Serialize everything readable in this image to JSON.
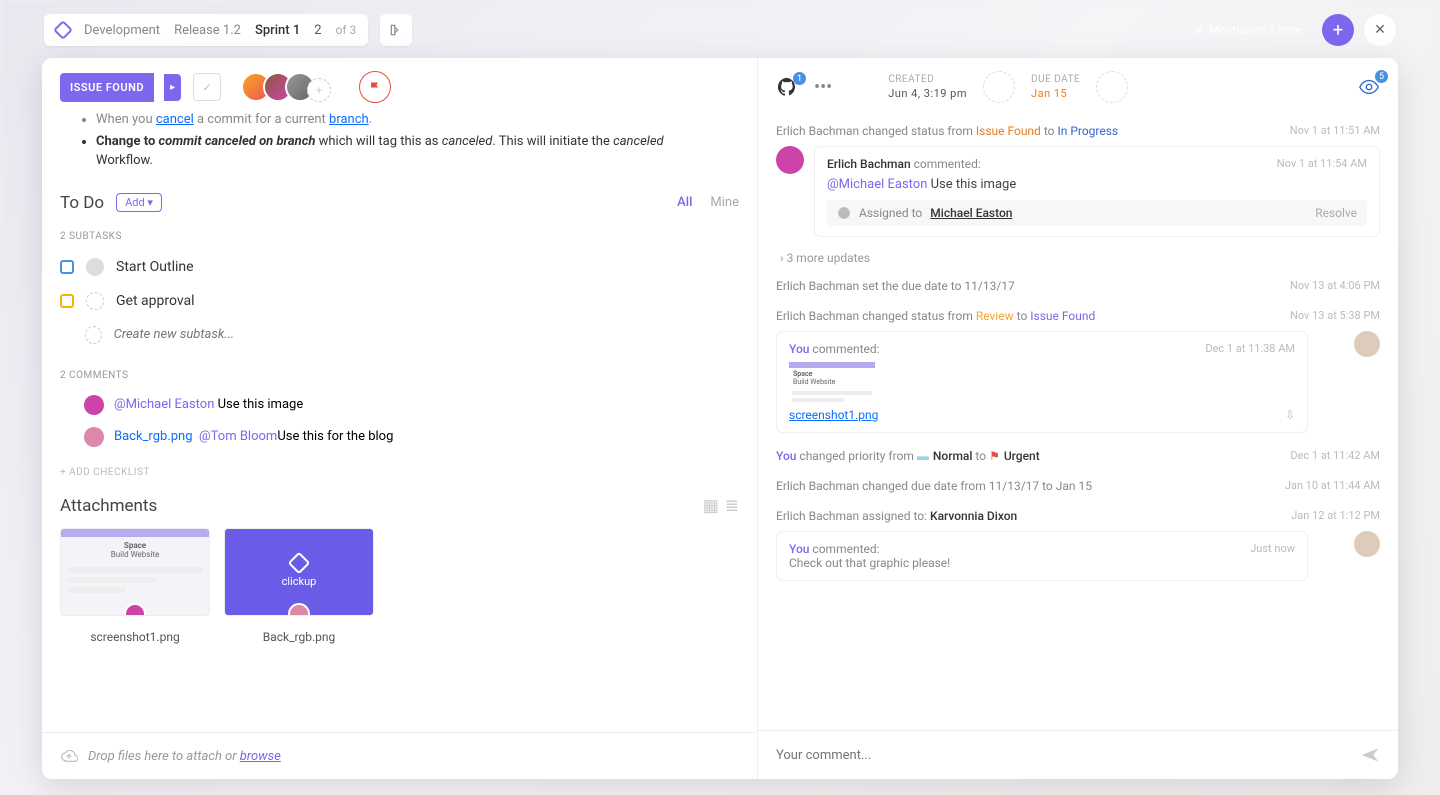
{
  "breadcrumb": {
    "space": "Development",
    "release": "Release 1.2",
    "sprint": "Sprint 1",
    "index": "2",
    "of": "of 3"
  },
  "topbar": {
    "mention_label": "Mentioned 1 time"
  },
  "task": {
    "status_label": "ISSUE FOUND",
    "created_label": "CREATED",
    "created_value": "Jun 4, 3:19 pm",
    "due_label": "DUE DATE",
    "due_value": "Jan 15",
    "github_count": "1",
    "watch_count": "5"
  },
  "description": {
    "line1_prefix": "When you ",
    "line1_cancel": "cancel",
    "line1_mid": " a commit for a current ",
    "line1_branch": "branch",
    "line2_prefix": "Change to ",
    "line2_bolditalic": "commit canceled on branch",
    "line2_mid": " which will tag this as ",
    "line2_canceled": "canceled",
    "line2_mid2": ". This will initiate the ",
    "line2_canceled2": "canceled",
    "line3": "Workflow."
  },
  "todo": {
    "title": "To Do",
    "add_label": "Add",
    "filter_all": "All",
    "filter_mine": "Mine",
    "subtasks_header": "2 SUBTASKS",
    "items": [
      {
        "name": "Start Outline",
        "color": "blue"
      },
      {
        "name": "Get approval",
        "color": "yellow"
      }
    ],
    "new_placeholder": "Create new subtask...",
    "comments_header": "2 COMMENTS",
    "comments": [
      {
        "mention": "@Michael Easton",
        "text": " Use this image"
      },
      {
        "file": "Back_rgb.png",
        "mention": "@Tom Bloom",
        "text": "Use this for the blog"
      }
    ],
    "add_checklist": "+ ADD CHECKLIST"
  },
  "attachments": {
    "title": "Attachments",
    "files": [
      {
        "name": "screenshot1.png"
      },
      {
        "name": "Back_rgb.png"
      }
    ]
  },
  "left_footer": {
    "text": "Drop files here to attach or ",
    "link": "browse"
  },
  "activity": {
    "row1_prefix": "Erlich Bachman changed status from",
    "row1_from": "Issue Found",
    "row1_to_word": "to",
    "row1_to": "In Progress",
    "row1_ts": "Nov 1 at 11:51 AM",
    "comment1_author": "Erlich Bachman",
    "comment1_verb": "commented:",
    "comment1_ts": "Nov 1 at 11:54 AM",
    "comment1_mention": "@Michael Easton",
    "comment1_text": " Use this image",
    "comment1_assigned_label": "Assigned to",
    "comment1_assigned_name": "Michael Easton",
    "comment1_resolve": "Resolve",
    "more_updates": "› 3 more updates",
    "row2_text": "Erlich Bachman set the due date to 11/13/17",
    "row2_ts": "Nov 13 at 4:06 PM",
    "row3_prefix": "Erlich Bachman changed status from",
    "row3_from": "Review",
    "row3_to": "Issue Found",
    "row3_ts": "Nov 13 at 5:38 PM",
    "comment2_you": "You",
    "comment2_verb": " commented:",
    "comment2_ts": "Dec 1 at 11:38 AM",
    "comment2_file": "screenshot1.png",
    "row4_you": "You",
    "row4_text": " changed priority from ",
    "row4_from": "Normal",
    "row4_to_word": " to ",
    "row4_to": "Urgent",
    "row4_ts": "Dec 1 at 11:42 AM",
    "row5_text": "Erlich Bachman changed due date from 11/13/17 to Jan 15",
    "row5_ts": "Jan 10 at 11:44 AM",
    "row6_prefix": "Erlich Bachman assigned to: ",
    "row6_name": "Karvonnia Dixon",
    "row6_ts": "Jan 12 at 1:12 PM",
    "comment3_you": "You",
    "comment3_verb": " commented:",
    "comment3_ts": "Just now",
    "comment3_text": "Check out that graphic please!"
  },
  "right_footer": {
    "placeholder": "Your comment..."
  }
}
